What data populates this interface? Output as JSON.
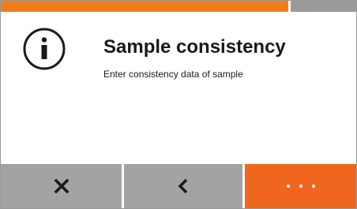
{
  "progress": {
    "value": 0.81
  },
  "dialog": {
    "icon": "info-icon",
    "title": "Sample consistency",
    "subtitle": "Enter consistency data of sample"
  },
  "buttons": {
    "close": {
      "icon": "close-icon"
    },
    "back": {
      "icon": "chevron-left-icon"
    },
    "more": {
      "icon": "more-dots-icon"
    }
  },
  "colors": {
    "accent": "#f07d1a",
    "more_button": "#f0661e",
    "button_gray": "#a3a3a3",
    "text": "#1a1a1a"
  }
}
